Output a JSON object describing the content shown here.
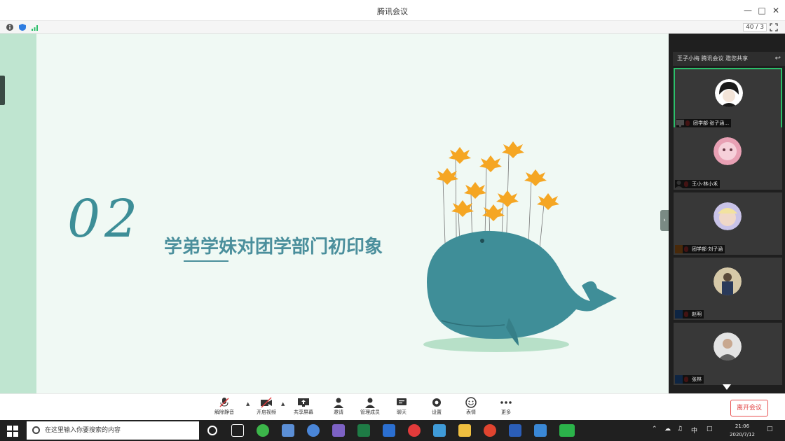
{
  "window": {
    "title": "腾讯会议",
    "minimize_icon": "minimize-icon",
    "maximize_icon": "maximize-icon",
    "close_icon": "close-icon"
  },
  "infobar": {
    "page_indicator": "40 / 3"
  },
  "slide": {
    "number": "02",
    "title": "学弟学妹对团学部门初印象",
    "colors": {
      "accent": "#4b8f9c",
      "background": "#f0f9f4",
      "band": "#bfe5d0"
    }
  },
  "panel": {
    "header": "王子小梅 腾讯会议 邀您共享",
    "participants": [
      {
        "name": "团学部·张子涵…",
        "avatar_color": "#2a2a2a",
        "active": true
      },
      {
        "name": "王小·林小禾",
        "avatar_color": "#e8a0b4",
        "active": false
      },
      {
        "name": "团学部·刘子涵",
        "avatar_color": "#f0d8c8",
        "active": false
      },
      {
        "name": "赵明",
        "avatar_color": "#d6c9a8",
        "active": false
      },
      {
        "name": "张林",
        "avatar_color": "#e4e4e4",
        "active": false
      }
    ]
  },
  "toolbar": {
    "buttons": [
      {
        "label": "解除静音",
        "icon": "microphone-icon"
      },
      {
        "label": "开启视频",
        "icon": "camera-icon"
      },
      {
        "label": "共享屏幕",
        "icon": "screen-share-icon"
      },
      {
        "label": "邀请",
        "icon": "invite-icon"
      },
      {
        "label": "管理成员",
        "icon": "members-icon"
      },
      {
        "label": "聊天",
        "icon": "chat-icon"
      },
      {
        "label": "设置",
        "icon": "settings-icon"
      },
      {
        "label": "表情",
        "icon": "emoji-icon"
      },
      {
        "label": "更多",
        "icon": "more-icon"
      }
    ],
    "end_meeting": "离开会议"
  },
  "taskbar": {
    "search_placeholder": "在这里输入你要搜索的内容",
    "ime": "中",
    "time": "21:06",
    "date": "2020/7/12"
  }
}
